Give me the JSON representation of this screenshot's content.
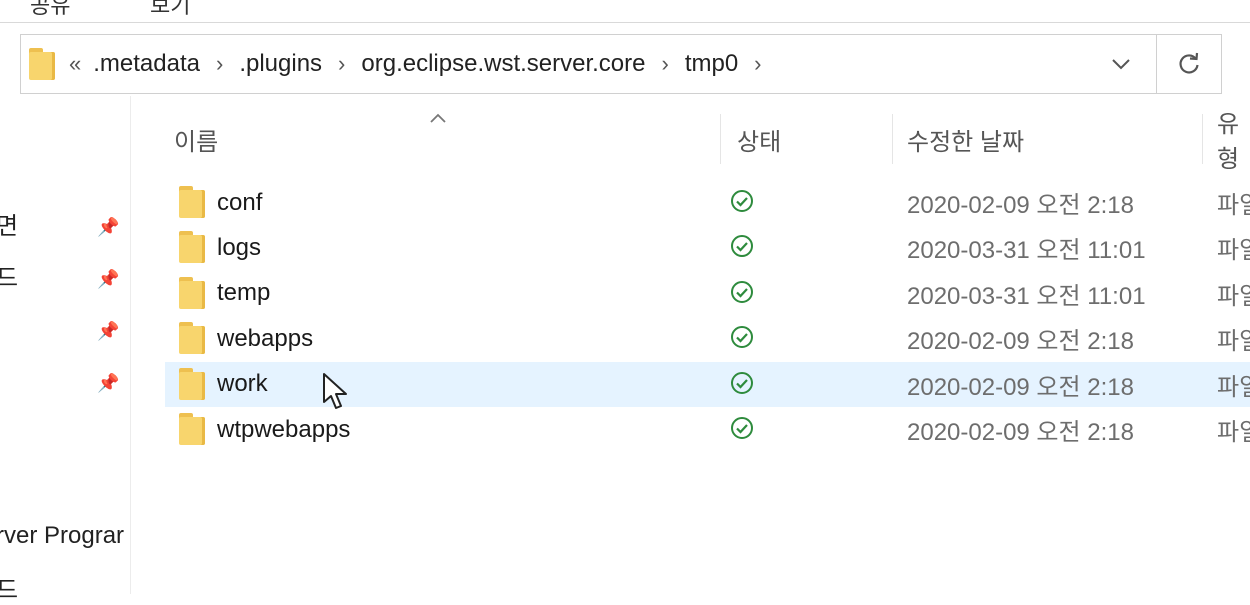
{
  "top_fragments": [
    "공유",
    "보기"
  ],
  "address_bar": {
    "overflow": "«",
    "crumbs": [
      ".metadata",
      ".plugins",
      "org.eclipse.wst.server.core",
      "tmp0"
    ]
  },
  "columns": {
    "name": "이름",
    "status": "상태",
    "date": "수정한 날짜",
    "type": "유형"
  },
  "sidebar": {
    "fragments": [
      "면",
      "드",
      "rver Prograr",
      "드"
    ]
  },
  "files": [
    {
      "name": "conf",
      "date": "2020-02-09 오전 2:18",
      "type": "파일 폴더"
    },
    {
      "name": "logs",
      "date": "2020-03-31 오전 11:01",
      "type": "파일 폴더"
    },
    {
      "name": "temp",
      "date": "2020-03-31 오전 11:01",
      "type": "파일 폴더"
    },
    {
      "name": "webapps",
      "date": "2020-02-09 오전 2:18",
      "type": "파일 폴더"
    },
    {
      "name": "work",
      "date": "2020-02-09 오전 2:18",
      "type": "파일 폴더",
      "hovered": true
    },
    {
      "name": "wtpwebapps",
      "date": "2020-02-09 오전 2:18",
      "type": "파일 폴더"
    }
  ],
  "colors": {
    "hover_row": "#e5f3ff",
    "status_green": "#2e8b3d",
    "folder": "#f8d56d"
  }
}
